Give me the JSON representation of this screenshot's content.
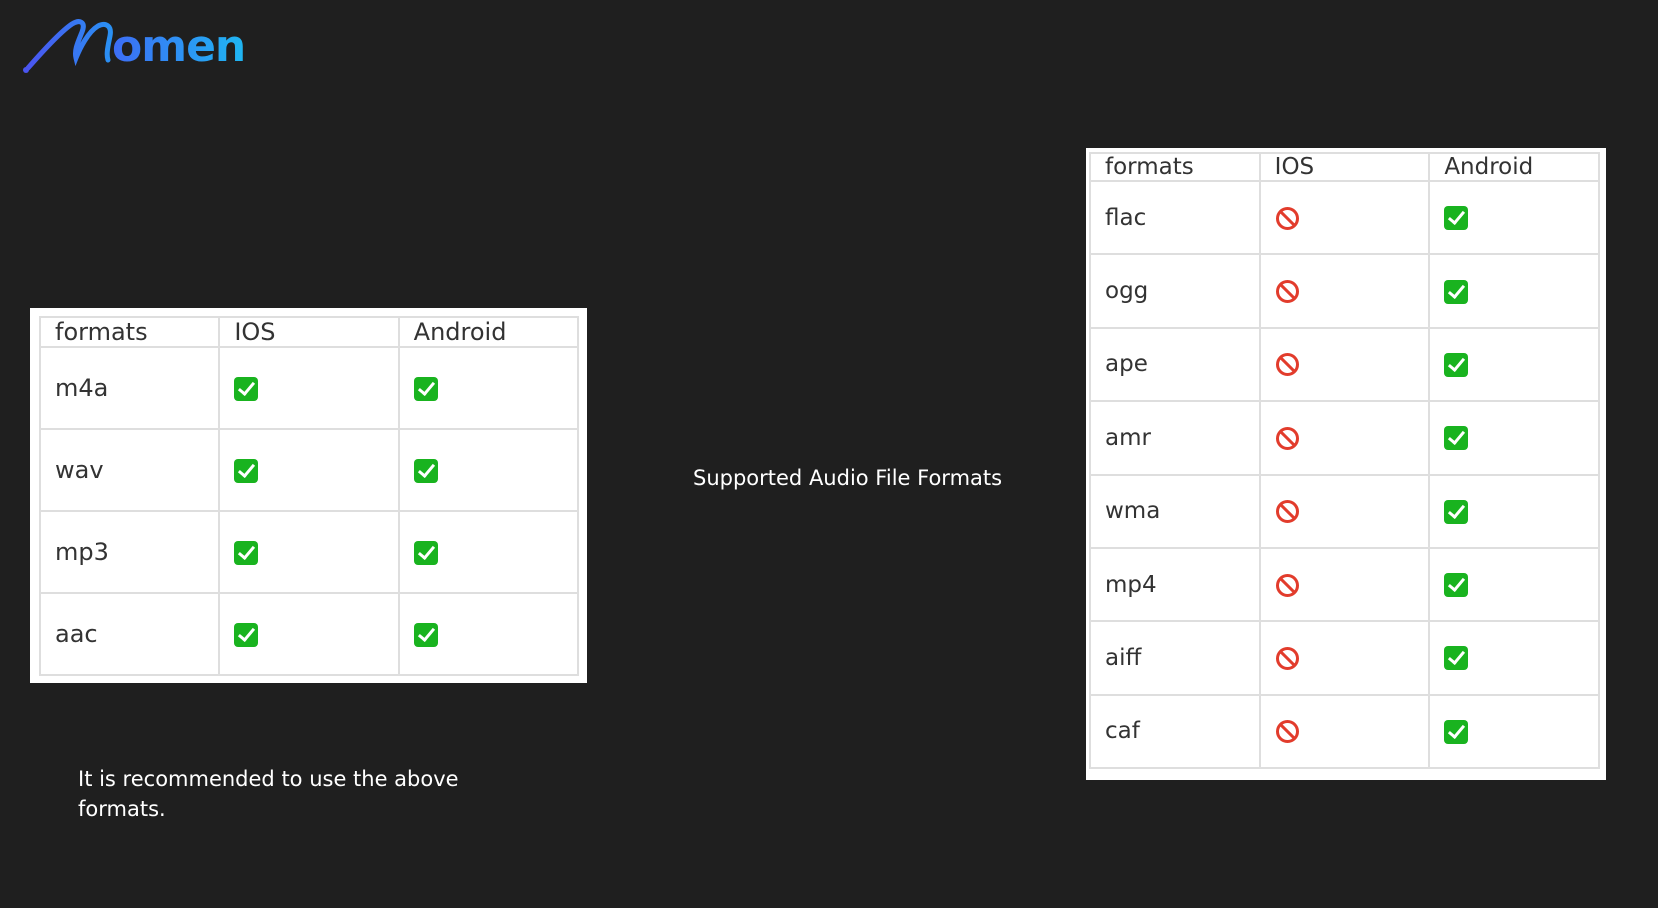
{
  "logo": {
    "text": "omen",
    "accent_start": "#4a55f0",
    "accent_end": "#1fb6f2"
  },
  "caption": "Supported Audio File Formats",
  "note": "It is recommended to use the above formats.",
  "colors": {
    "background": "#1f1f1f",
    "supported": "#19b31f",
    "unsupported": "#e23c2c"
  },
  "recommended_table": {
    "headers": [
      "formats",
      "IOS",
      "Android"
    ],
    "rows": [
      {
        "format": "m4a",
        "ios": "supported",
        "android": "supported"
      },
      {
        "format": "wav",
        "ios": "supported",
        "android": "supported"
      },
      {
        "format": "mp3",
        "ios": "supported",
        "android": "supported"
      },
      {
        "format": "aac",
        "ios": "supported",
        "android": "supported"
      }
    ]
  },
  "android_only_table": {
    "headers": [
      "formats",
      "IOS",
      "Android"
    ],
    "rows": [
      {
        "format": "flac",
        "ios": "unsupported",
        "android": "supported"
      },
      {
        "format": "ogg",
        "ios": "unsupported",
        "android": "supported"
      },
      {
        "format": "ape",
        "ios": "unsupported",
        "android": "supported"
      },
      {
        "format": "amr",
        "ios": "unsupported",
        "android": "supported"
      },
      {
        "format": "wma",
        "ios": "unsupported",
        "android": "supported"
      },
      {
        "format": "mp4",
        "ios": "unsupported",
        "android": "supported"
      },
      {
        "format": "aiff",
        "ios": "unsupported",
        "android": "supported"
      },
      {
        "format": "caf",
        "ios": "unsupported",
        "android": "supported"
      }
    ]
  }
}
